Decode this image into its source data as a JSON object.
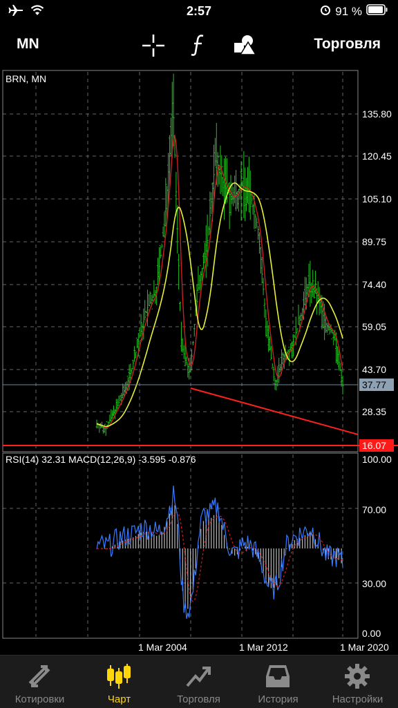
{
  "status_bar": {
    "time": "2:57",
    "battery": "91 %"
  },
  "toolbar": {
    "timeframe": "MN",
    "trade_label": "Торговля"
  },
  "main_chart": {
    "title": "BRN, MN",
    "price_labels": [
      "135.80",
      "120.45",
      "105.10",
      "89.75",
      "74.40",
      "59.05",
      "43.70",
      "28.35"
    ],
    "current_price": "37.77",
    "level_price": "16.07"
  },
  "indicator": {
    "title": "RSI(14) 32.31 MACD(12,26,9) -3.595 -0.876",
    "levels": [
      "100.00",
      "70.00",
      "30.00",
      "0.00"
    ]
  },
  "x_axis": {
    "labels": [
      "1 Mar 2004",
      "1 Mar 2012",
      "1 Mar 2020"
    ]
  },
  "tabs": [
    {
      "label": "Котировки",
      "icon": "quotes-icon"
    },
    {
      "label": "Чарт",
      "icon": "chart-candles-icon"
    },
    {
      "label": "Торговля",
      "icon": "trade-icon"
    },
    {
      "label": "История",
      "icon": "history-icon"
    },
    {
      "label": "Настройки",
      "icon": "settings-icon"
    }
  ],
  "colors": {
    "accent": "#ffd60a",
    "candles": "#22c322",
    "ma_fast": "#cc1f1f",
    "ma_slow": "#e6f23a",
    "trendline": "#ff2020",
    "rsi": "#3a7bff"
  },
  "chart_data": {
    "type": "line",
    "x": [
      "1 Mar 2004",
      "1 Mar 2012",
      "1 Mar 2020"
    ],
    "ylim": [
      16.07,
      135.8
    ],
    "series": [
      {
        "values": [
          24,
          22,
          28,
          34,
          42,
          55,
          66,
          72,
          96,
          139,
          52,
          42,
          74,
          88,
          120,
          110,
          105,
          110,
          108,
          95,
          60,
          38,
          48,
          52,
          62,
          75,
          70,
          60,
          56,
          37.77
        ]
      }
    ]
  }
}
